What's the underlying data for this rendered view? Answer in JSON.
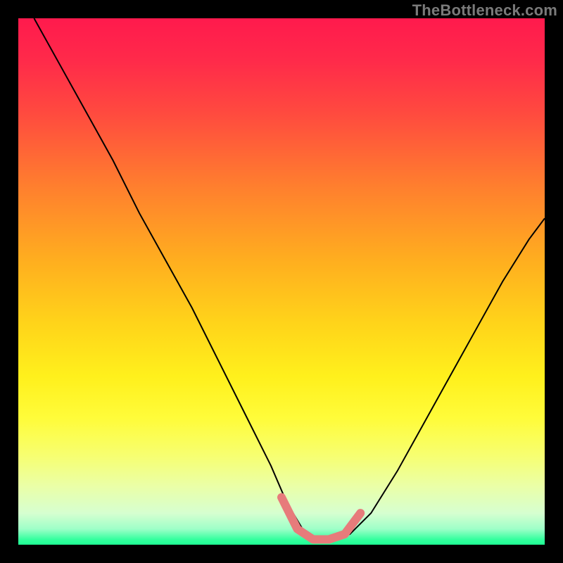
{
  "watermark": "TheBottleneck.com",
  "colors": {
    "black_curve": "#000000",
    "pink_stroke": "#e77b7b",
    "background": "#000000"
  },
  "chart_data": {
    "type": "line",
    "title": "",
    "xlabel": "",
    "ylabel": "",
    "xlim": [
      0,
      100
    ],
    "ylim": [
      0,
      100
    ],
    "grid": false,
    "legend": false,
    "series": [
      {
        "name": "curve",
        "color": "#000000",
        "x": [
          3,
          8,
          13,
          18,
          23,
          28,
          33,
          38,
          43,
          48,
          51,
          54,
          57,
          60,
          63,
          67,
          72,
          77,
          82,
          87,
          92,
          97,
          100
        ],
        "y": [
          100,
          91,
          82,
          73,
          63,
          54,
          45,
          35,
          25,
          15,
          8,
          3,
          1,
          1,
          2,
          6,
          14,
          23,
          32,
          41,
          50,
          58,
          62
        ]
      },
      {
        "name": "highlight",
        "color": "#e77b7b",
        "x": [
          50,
          53,
          56,
          59,
          62,
          65
        ],
        "y": [
          9,
          3,
          1,
          1,
          2,
          6
        ]
      }
    ]
  }
}
